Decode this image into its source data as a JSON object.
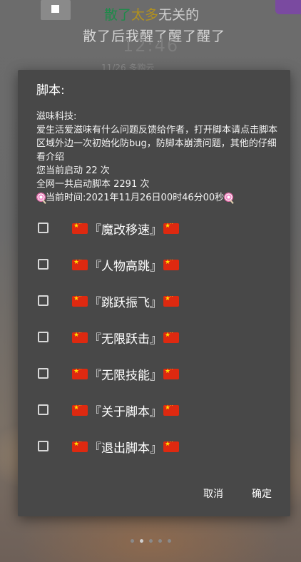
{
  "background": {
    "marquee_parts": [
      "散了",
      "太多",
      "无关的"
    ],
    "subtitle": "散了后我醒了醒了醒了",
    "clock": "12:46",
    "date": "11/26    多购云"
  },
  "dialog": {
    "title": "脚本:",
    "message_lines": [
      "滋味科技:",
      "爱生活爱滋味有什么问题反馈给作者，打开脚本请点击脚本区域外边一次初始化防bug，防脚本崩溃问题，其他的仔细看介绍",
      "您当前启动 22 次",
      "全网一共启动脚本 2291 次",
      "当前时间:2021年11月26日00时46分00秒"
    ],
    "options": [
      {
        "label": "『魔改移速』",
        "checked": false
      },
      {
        "label": "『人物高跳』",
        "checked": false
      },
      {
        "label": "『跳跃振飞』",
        "checked": false
      },
      {
        "label": "『无限跃击』",
        "checked": false
      },
      {
        "label": "『无限技能』",
        "checked": false
      },
      {
        "label": "『关于脚本』",
        "checked": false
      },
      {
        "label": "『退出脚本』",
        "checked": false
      }
    ],
    "cancel_label": "取消",
    "confirm_label": "确定"
  },
  "colors": {
    "dialog_bg": "#484848",
    "text": "#ffffff",
    "flag_red": "#de2910",
    "flag_star": "#ffde00"
  }
}
